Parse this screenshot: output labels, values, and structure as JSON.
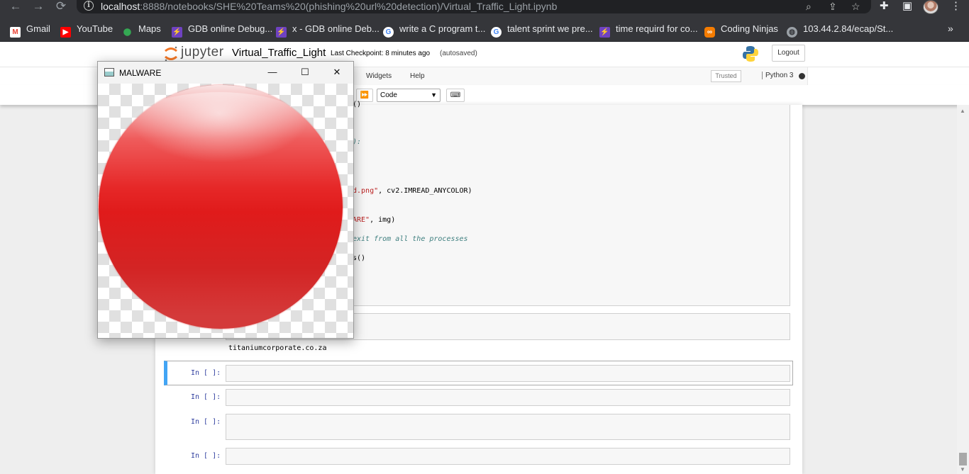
{
  "browser": {
    "url_host": "localhost",
    "url_path": ":8888/notebooks/SHE%20Teams%20(phishing%20url%20detection)/Virtual_Traffic_Light.ipynb",
    "bookmarks": [
      {
        "label": "Gmail",
        "icon": "gmail-icon",
        "color": "#ea4335"
      },
      {
        "label": "YouTube",
        "icon": "youtube-icon",
        "color": "#ff0000"
      },
      {
        "label": "Maps",
        "icon": "maps-icon",
        "color": "#34a853"
      },
      {
        "label": "GDB online Debug...",
        "icon": "gdb-icon",
        "color": "#6f42c1"
      },
      {
        "label": "x - GDB online Deb...",
        "icon": "gdb-icon",
        "color": "#6f42c1"
      },
      {
        "label": "write a C program t...",
        "icon": "google-icon",
        "color": "#4285f4"
      },
      {
        "label": "talent sprint we pre...",
        "icon": "google-icon",
        "color": "#4285f4"
      },
      {
        "label": "time requird for co...",
        "icon": "gdb-icon",
        "color": "#6f42c1"
      },
      {
        "label": "Coding Ninjas",
        "icon": "coding-ninjas-icon",
        "color": "#f57c00"
      },
      {
        "label": "103.44.2.84/ecap/St...",
        "icon": "globe-icon",
        "color": "#9aa0a6"
      }
    ]
  },
  "jupyter": {
    "logo_text": "jupyter",
    "notebook_name": "Virtual_Traffic_Light",
    "checkpoint": "Last Checkpoint: 8 minutes ago",
    "autosaved": "(autosaved)",
    "logout": "Logout",
    "menu": {
      "widgets": "Widgets",
      "help": "Help"
    },
    "trusted": "Trusted",
    "kernel": "Python 3",
    "cell_type": "Code",
    "run_all_glyph": "⏩",
    "keyboard_glyph": "⌨"
  },
  "code": {
    "lines": [
      {
        "text": "()",
        "kind": "plain"
      },
      {
        "text": "):",
        "kind": "com"
      },
      {
        "text_str": "d.png\"",
        "text_rest": ", cv2.IMREAD_ANYCOLOR)",
        "kind": "mixed"
      },
      {
        "text_str": "ARE\"",
        "text_rest": ", img)",
        "kind": "mixed"
      },
      {
        "text": "exit from all the processes",
        "kind": "com"
      },
      {
        "text": "s()",
        "kind": "plain"
      }
    ],
    "output": "titaniumcorporate.co.za"
  },
  "cells": [
    {
      "prompt": "In [ ]:"
    },
    {
      "prompt": "In [ ]:"
    },
    {
      "prompt": "In [ ]:"
    },
    {
      "prompt": "In [ ]:"
    }
  ],
  "window": {
    "title": "MALWARE",
    "minimize_glyph": "—",
    "maximize_glyph": "☐",
    "close_glyph": "✕",
    "ball_color": "#e01b1b"
  }
}
